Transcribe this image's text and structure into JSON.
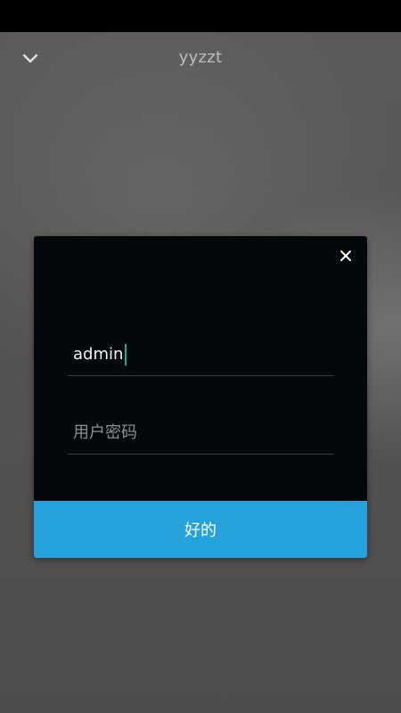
{
  "header": {
    "title": "yyzzt",
    "back_icon": "chevron-down-icon"
  },
  "dialog": {
    "close_icon": "close-icon",
    "username": {
      "value": "admin"
    },
    "password": {
      "placeholder": "用户密码",
      "value": ""
    },
    "confirm_label": "好的"
  },
  "colors": {
    "dialog_background": "#04070b",
    "accent_button": "#25a2dc",
    "caret": "#1fae8a",
    "divider": "#3a3d41"
  }
}
